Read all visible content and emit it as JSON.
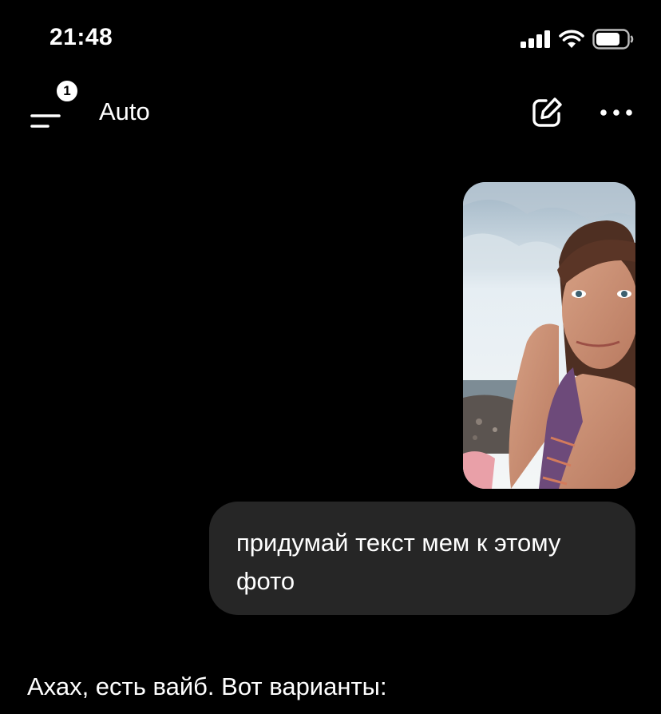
{
  "status_bar": {
    "time": "21:48",
    "icons": [
      "signal-icon",
      "wifi-icon",
      "battery-icon"
    ]
  },
  "header": {
    "menu_icon": "menu-icon",
    "badge_count": "1",
    "model_label": "Auto",
    "edit_icon": "edit-icon",
    "more_icon": "more-icon"
  },
  "conversation": {
    "user_image": "selfie photo on beach",
    "user_message": "придумай текст мем к этому фото",
    "assistant_message": "Ахах, есть вайб. Вот варианты:"
  },
  "colors": {
    "background": "#000000",
    "user_bubble": "#262626",
    "text": "#ffffff"
  }
}
